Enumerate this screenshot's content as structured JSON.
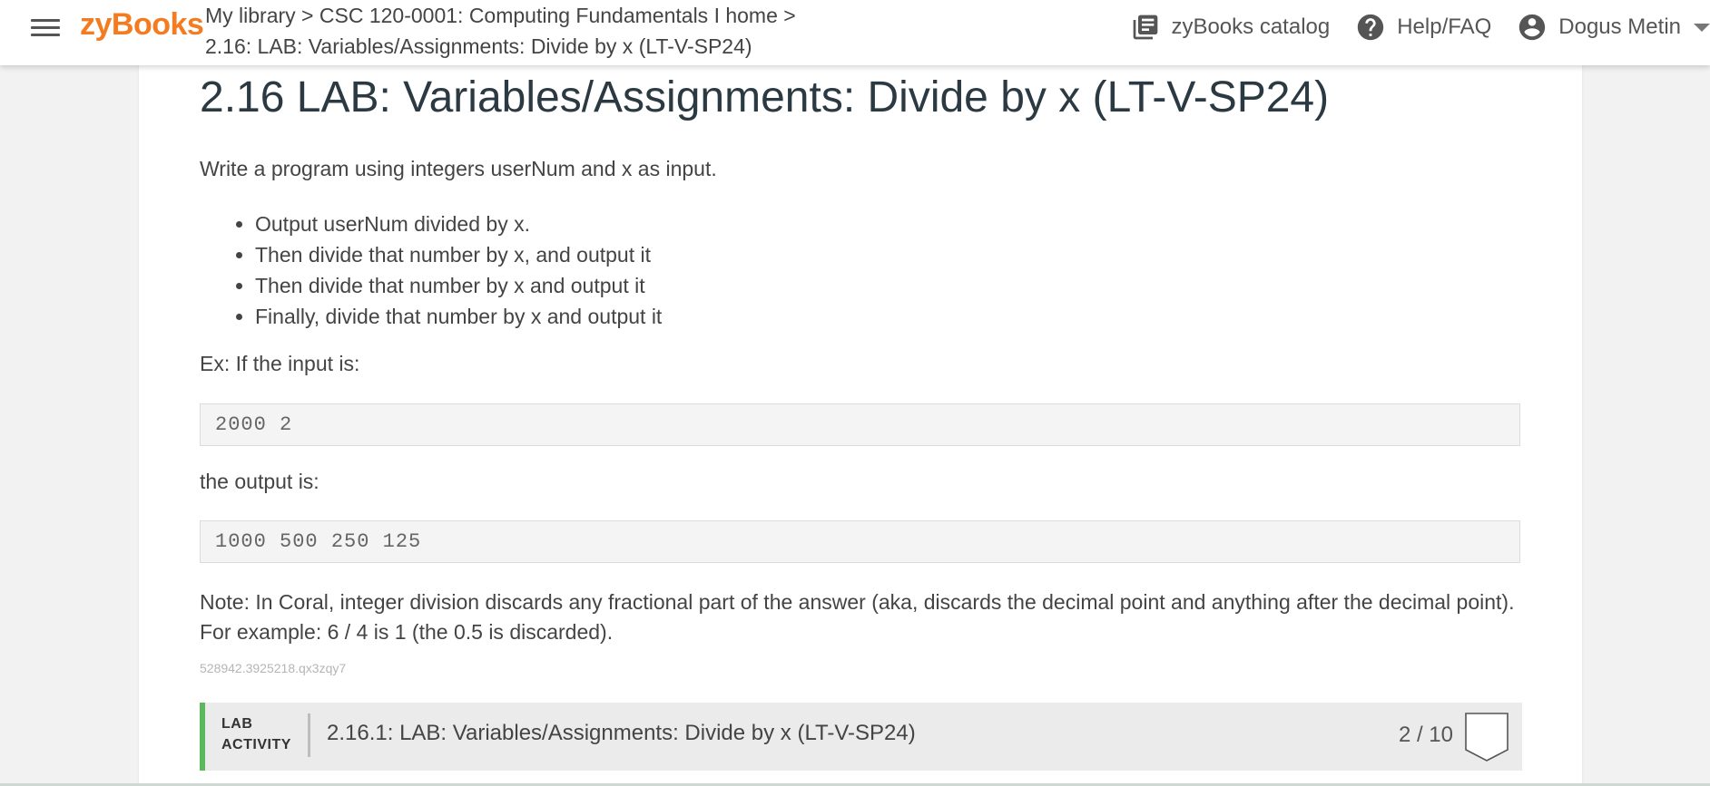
{
  "topbar": {
    "logo": "zyBooks",
    "breadcrumb_line1": "My library > CSC 120-0001: Computing Fundamentals I home >",
    "breadcrumb_line2": "2.16: LAB: Variables/Assignments: Divide by x (LT-V-SP24)",
    "catalog_label": "zyBooks catalog",
    "help_label": "Help/FAQ",
    "user_name": "Dogus Metin",
    "icons": [
      "menu-icon",
      "library-books-icon",
      "help-circle-icon",
      "account-circle-icon",
      "caret-down-icon"
    ]
  },
  "section": {
    "title": "2.16 LAB: Variables/Assignments: Divide by x (LT-V-SP24)",
    "intro": "Write a program using integers userNum and x as input.",
    "bullets": [
      "Output userNum divided by x.",
      "Then divide that number by x, and output it",
      "Then divide that number by x and output it",
      "Finally, divide that number by x and output it"
    ],
    "example_label": "Ex: If the input is:",
    "example_input": "2000 2",
    "output_label": "the output is:",
    "example_output": "1000 500 250 125",
    "note": "Note: In Coral, integer division discards any fractional part of the answer (aka, discards the decimal point and anything after the decimal point). For example: 6 / 4 is 1 (the 0.5 is discarded).",
    "content_id": "528942.3925218.qx3zqy7"
  },
  "lab_activity": {
    "tag_line1": "LAB",
    "tag_line2": "ACTIVITY",
    "title": "2.16.1: LAB: Variables/Assignments: Divide by x (LT-V-SP24)",
    "score": "2 / 10",
    "accent_color": "#5cb85c"
  },
  "colors": {
    "brand": "#f47b20",
    "title_text": "#2b3a42",
    "page_bg": "#f2f2f2"
  }
}
